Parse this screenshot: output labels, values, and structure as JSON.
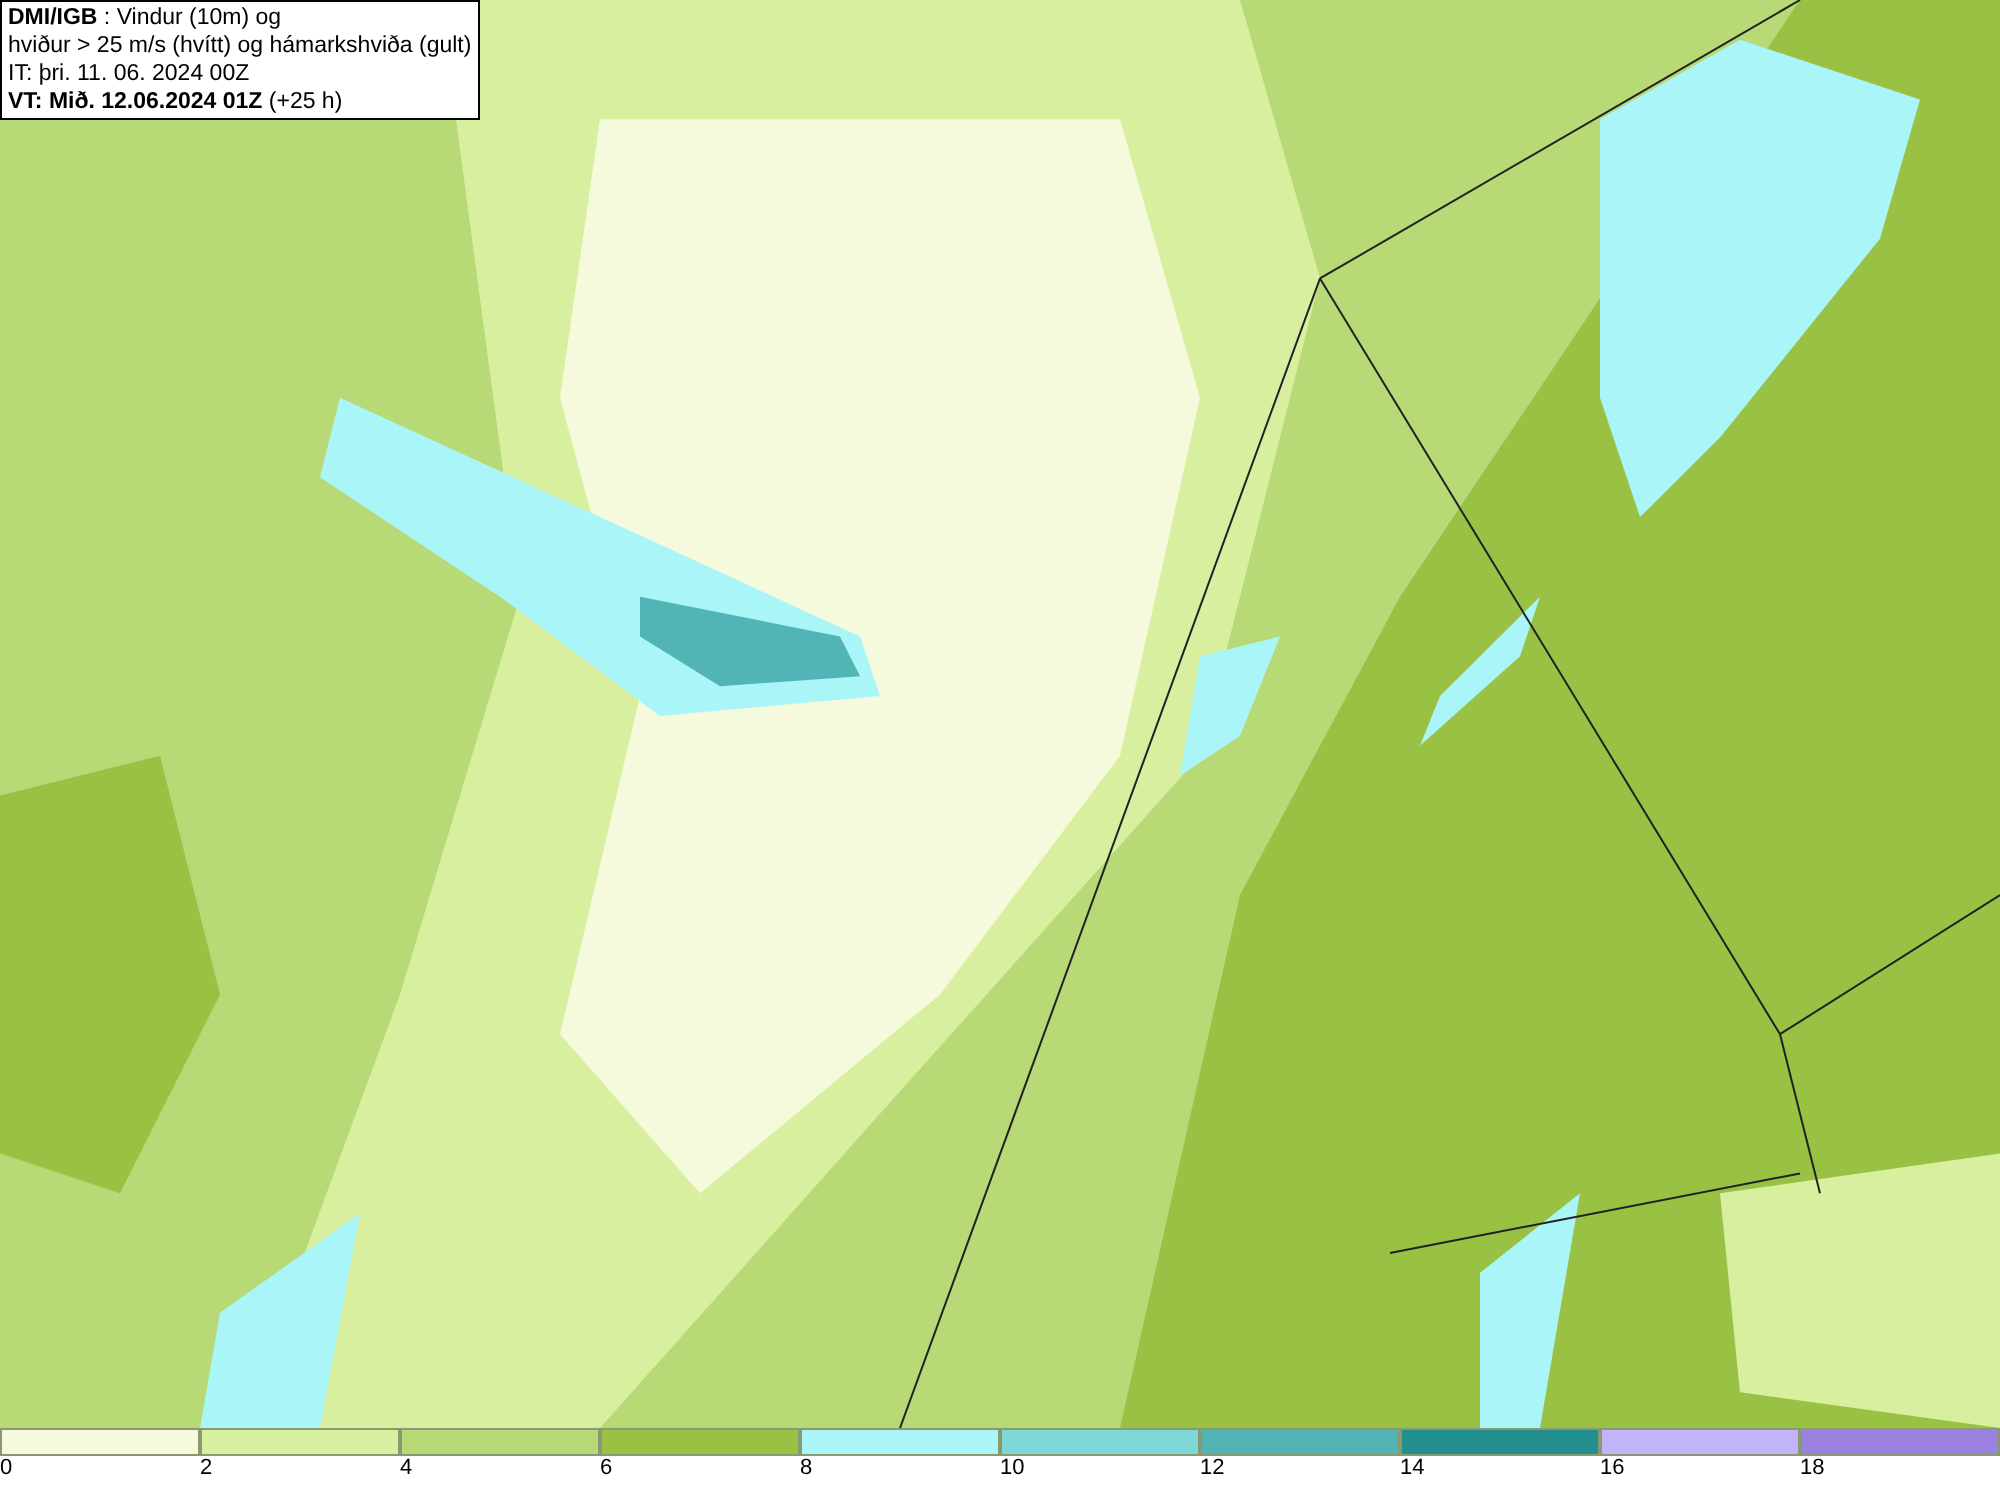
{
  "title_box": {
    "lines": [
      "**DMI/IGB** : Vindur (10m) og",
      "hviður > 25 m/s (hvítt) og hámarkshviða (gult)",
      "IT: þri. 11. 06. 2024 00Z",
      "**VT: Mið. 12.06.2024 01Z** (+25 h)"
    ]
  },
  "legend": {
    "bins": [
      {
        "label": "0",
        "color": "#f5fadc"
      },
      {
        "label": "2",
        "color": "#d8efa0"
      },
      {
        "label": "4",
        "color": "#b7d976"
      },
      {
        "label": "6",
        "color": "#99c144"
      },
      {
        "label": "8",
        "color": "#aaf5f8"
      },
      {
        "label": "10",
        "color": "#7dd8d8"
      },
      {
        "label": "12",
        "color": "#52b4b4"
      },
      {
        "label": "14",
        "color": "#228e8e"
      },
      {
        "label": "16",
        "color": "#c3b3f8"
      },
      {
        "label": "18",
        "color": "#9a82de"
      }
    ]
  }
}
